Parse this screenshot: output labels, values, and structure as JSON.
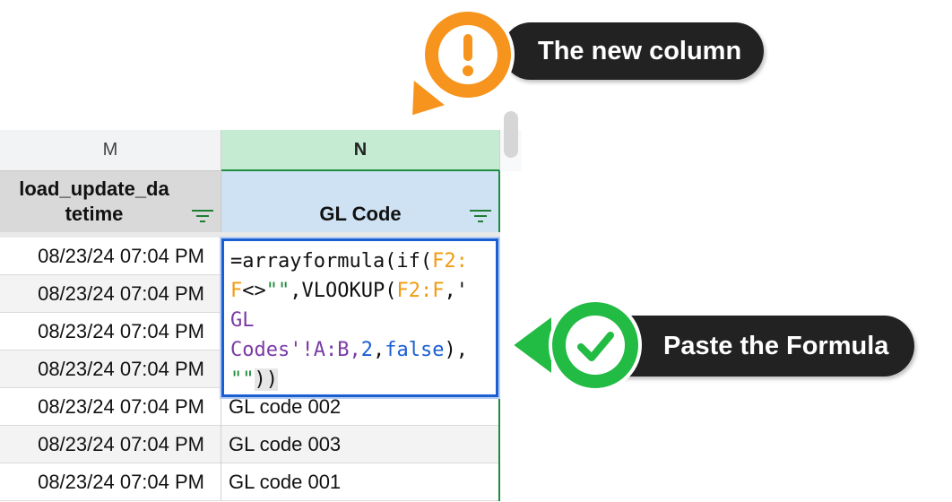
{
  "columns": {
    "m": "M",
    "n": "N"
  },
  "headers": {
    "m": "load_update_da\ntetime",
    "n": "GL Code"
  },
  "rows": [
    {
      "m": "08/23/24 07:04 PM",
      "n": ""
    },
    {
      "m": "08/23/24 07:04 PM",
      "n": ""
    },
    {
      "m": "08/23/24 07:04 PM",
      "n": ""
    },
    {
      "m": "08/23/24 07:04 PM",
      "n": ""
    },
    {
      "m": "08/23/24 07:04 PM",
      "n": "GL code 002"
    },
    {
      "m": "08/23/24 07:04 PM",
      "n": "GL code 003"
    },
    {
      "m": "08/23/24 07:04 PM",
      "n": "GL code 001"
    }
  ],
  "formula": {
    "p1": "=arrayformula(if(",
    "p2": "F2:",
    "p3": "F",
    "p4": "<>",
    "p5": "\"\"",
    "p6": ",VLOOKUP(",
    "p7": "F2:F",
    "p8": ",'",
    "p9": "GL",
    "p10": "Codes'",
    "p11": "!A:B,",
    "p12": "2",
    "p13": ",",
    "p14": "false",
    "p15": "),",
    "p16": "\"\"",
    "p17": "))"
  },
  "callouts": {
    "top": "The new column",
    "bottom": "Paste the Formula"
  },
  "icons": {
    "warning": "exclamation-icon",
    "check": "checkmark-icon",
    "filter": "filter-icon"
  },
  "colors": {
    "orange": "#f7941d",
    "green": "#1db954",
    "selection": "#1a5fd1",
    "header_green": "#c6ebd3"
  }
}
